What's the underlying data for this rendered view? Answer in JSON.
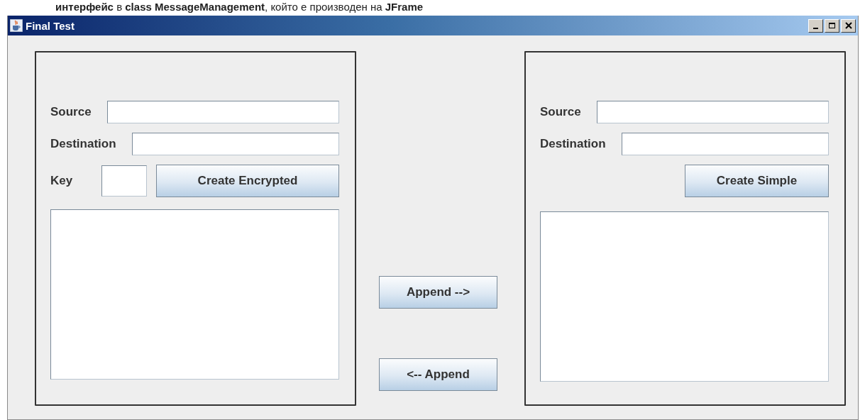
{
  "document_line": "**интерфейс** в **class MessageManagement**, който е производен на **JFrame**",
  "window": {
    "title": "Final Test"
  },
  "panels": [
    {
      "fields": [
        {
          "kind": "text",
          "label": "Source"
        },
        {
          "kind": "text",
          "label": "Destination"
        },
        {
          "kind": "key",
          "label": "Key"
        }
      ],
      "button": "Create Encrypted"
    },
    {
      "fields": [
        {
          "kind": "text",
          "label": "Source"
        },
        {
          "kind": "text",
          "label": "Destination"
        }
      ],
      "button": "Create Simple"
    }
  ],
  "middle_buttons": [
    "Append -->",
    "<-- Append"
  ]
}
